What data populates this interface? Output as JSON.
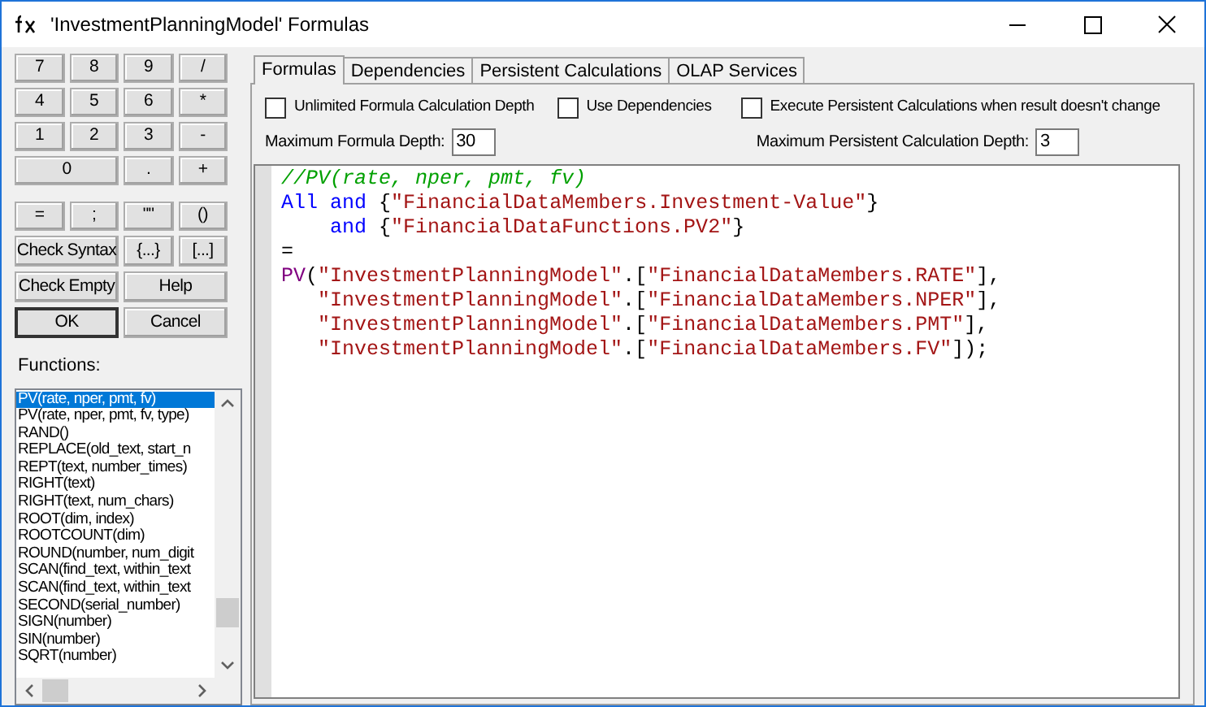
{
  "window": {
    "title": "'InvestmentPlanningModel' Formulas"
  },
  "keypad": [
    {
      "label": "7",
      "default": false
    },
    {
      "label": "8",
      "default": false
    },
    {
      "label": "9",
      "default": false
    },
    {
      "label": "/",
      "default": false
    },
    {
      "label": "4",
      "default": false
    },
    {
      "label": "5",
      "default": false
    },
    {
      "label": "6",
      "default": false
    },
    {
      "label": "*",
      "default": false
    },
    {
      "label": "1",
      "default": false
    },
    {
      "label": "2",
      "default": false
    },
    {
      "label": "3",
      "default": false
    },
    {
      "label": "-",
      "default": false
    },
    {
      "label": "0",
      "default": false
    },
    {
      "label": ".",
      "default": false
    },
    {
      "label": "+",
      "default": false
    }
  ],
  "actions": [
    {
      "label": "=",
      "default": false
    },
    {
      "label": ";",
      "default": false
    },
    {
      "label": "\"\"",
      "default": false
    },
    {
      "label": "()",
      "default": false
    },
    {
      "label": "Check Syntax",
      "default": false
    },
    {
      "label": "{...}",
      "default": false
    },
    {
      "label": "[...]",
      "default": false
    },
    {
      "label": "Check Empty",
      "default": false
    },
    {
      "label": "Help",
      "default": false
    },
    {
      "label": "OK",
      "default": true
    },
    {
      "label": "Cancel",
      "default": false
    }
  ],
  "functions": {
    "label": "Functions:",
    "items": [
      {
        "text": "PV(rate, nper, pmt, fv)",
        "selected": true
      },
      {
        "text": "PV(rate, nper, pmt, fv, type)",
        "selected": false
      },
      {
        "text": "RAND()",
        "selected": false
      },
      {
        "text": "REPLACE(old_text, start_n",
        "selected": false
      },
      {
        "text": "REPT(text, number_times)",
        "selected": false
      },
      {
        "text": "RIGHT(text)",
        "selected": false
      },
      {
        "text": "RIGHT(text, num_chars)",
        "selected": false
      },
      {
        "text": "ROOT(dim, index)",
        "selected": false
      },
      {
        "text": "ROOTCOUNT(dim)",
        "selected": false
      },
      {
        "text": "ROUND(number, num_digit",
        "selected": false
      },
      {
        "text": "SCAN(find_text, within_text",
        "selected": false
      },
      {
        "text": "SCAN(find_text, within_text",
        "selected": false
      },
      {
        "text": "SECOND(serial_number)",
        "selected": false
      },
      {
        "text": "SIGN(number)",
        "selected": false
      },
      {
        "text": "SIN(number)",
        "selected": false
      },
      {
        "text": "SQRT(number)",
        "selected": false
      }
    ]
  },
  "tabs": [
    {
      "label": "Formulas",
      "selected": true
    },
    {
      "label": "Dependencies",
      "selected": false
    },
    {
      "label": "Persistent Calculations",
      "selected": false
    },
    {
      "label": "OLAP Services",
      "selected": false
    }
  ],
  "options": [
    {
      "label": "Unlimited Formula Calculation Depth",
      "checked": false
    },
    {
      "label": "Use Dependencies",
      "checked": false
    },
    {
      "label": "Execute Persistent Calculations when result doesn't change",
      "checked": false
    }
  ],
  "depth_fields": [
    {
      "label": "Maximum Formula Depth:",
      "value": "30"
    },
    {
      "label": "Maximum Persistent Calculation Depth:",
      "value": "3"
    }
  ],
  "editor": {
    "lines": [
      [
        {
          "text": "//PV(rate, nper, pmt, fv)",
          "kind": "comment"
        }
      ],
      [
        {
          "text": "All",
          "kind": "keyword"
        },
        {
          "text": " and",
          "kind": "keyword"
        },
        {
          "text": " {",
          "kind": "plain"
        },
        {
          "text": "\"FinancialDataMembers.Investment-Value\"",
          "kind": "string"
        },
        {
          "text": "}",
          "kind": "plain"
        }
      ],
      [
        {
          "text": "    and",
          "kind": "keyword"
        },
        {
          "text": " {",
          "kind": "plain"
        },
        {
          "text": "\"FinancialDataFunctions.PV2\"",
          "kind": "string"
        },
        {
          "text": "}",
          "kind": "plain"
        }
      ],
      [
        {
          "text": "=",
          "kind": "plain"
        }
      ],
      [
        {
          "text": "PV",
          "kind": "function"
        },
        {
          "text": "(",
          "kind": "plain"
        },
        {
          "text": "\"InvestmentPlanningModel\"",
          "kind": "string"
        },
        {
          "text": ".[",
          "kind": "plain"
        },
        {
          "text": "\"FinancialDataMembers.RATE\"",
          "kind": "string"
        },
        {
          "text": "],",
          "kind": "plain"
        }
      ],
      [
        {
          "text": "   \"InvestmentPlanningModel\"",
          "kind": "string"
        },
        {
          "text": ".[",
          "kind": "plain"
        },
        {
          "text": "\"FinancialDataMembers.NPER\"",
          "kind": "string"
        },
        {
          "text": "],",
          "kind": "plain"
        }
      ],
      [
        {
          "text": "   \"InvestmentPlanningModel\"",
          "kind": "string"
        },
        {
          "text": ".[",
          "kind": "plain"
        },
        {
          "text": "\"FinancialDataMembers.PMT\"",
          "kind": "string"
        },
        {
          "text": "],",
          "kind": "plain"
        }
      ],
      [
        {
          "text": "   \"InvestmentPlanningModel\"",
          "kind": "string"
        },
        {
          "text": ".[",
          "kind": "plain"
        },
        {
          "text": "\"FinancialDataMembers.FV\"",
          "kind": "string"
        },
        {
          "text": "]);",
          "kind": "plain"
        }
      ]
    ]
  }
}
